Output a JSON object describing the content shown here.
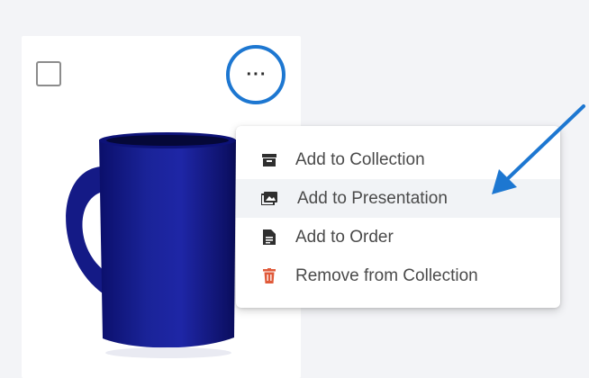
{
  "product_card": {
    "select_checkbox": {
      "checked": false
    },
    "more_button": {
      "label": "···"
    },
    "image": {
      "subject": "blue-mug"
    }
  },
  "context_menu": {
    "items": [
      {
        "label": "Add to Collection",
        "icon": "archive-box-icon",
        "icon_color": "#2f2f2f"
      },
      {
        "label": "Add to Presentation",
        "icon": "presentation-image-icon",
        "icon_color": "#2f2f2f",
        "highlighted": true
      },
      {
        "label": "Add to Order",
        "icon": "document-icon",
        "icon_color": "#2f2f2f"
      },
      {
        "label": "Remove from Collection",
        "icon": "trash-icon",
        "icon_color": "#e05a3a"
      }
    ]
  },
  "annotations": {
    "ring_color": "#1d77d1",
    "arrow_color": "#1d77d1"
  }
}
